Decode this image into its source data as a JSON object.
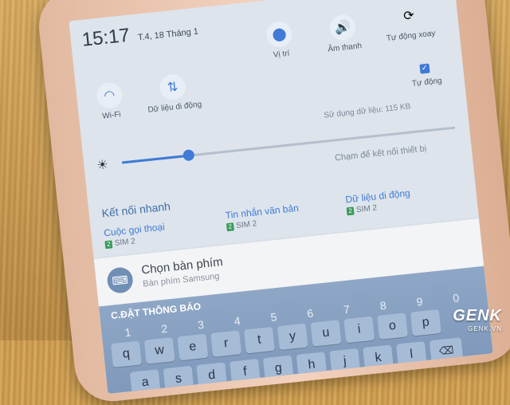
{
  "status": {
    "time": "15:17",
    "date": "T.4, 18 Tháng 1"
  },
  "toggles_row1": [
    {
      "label": "Âm thanh",
      "icon": "volume-icon",
      "active": true
    },
    {
      "label": "Tự động xoay",
      "icon": "rotate-icon",
      "active": false
    }
  ],
  "toggles_row1_left": [
    {
      "label": "Vị trí",
      "icon": "location-icon",
      "active": true
    }
  ],
  "toggles_row2": [
    {
      "label": "Wi-Fi",
      "icon": "wifi-icon",
      "active": true
    },
    {
      "label": "Dữ liệu di động",
      "icon": "mobile-data-icon",
      "active": true
    }
  ],
  "auto_brightness": {
    "label": "Tự động",
    "checked": true
  },
  "data_usage": "Sử dụng dữ liệu: 115 KB",
  "brightness_level": 0.2,
  "connect_hint": "Chạm để kết nối thiết bị",
  "quick_connect": {
    "title": "Kết nối nhanh",
    "items": [
      {
        "label": "Cuộc gọi thoại",
        "sim": "SIM 2"
      },
      {
        "label": "Tin nhắn văn bản",
        "sim": "SIM 2"
      },
      {
        "label": "Dữ liệu di động",
        "sim": "SIM 2"
      }
    ]
  },
  "notification": {
    "title": "Chọn bàn phím",
    "subtitle": "Bàn phím Samsung"
  },
  "keyboard": {
    "settings_label": "C.ĐẶT THÔNG BÁO",
    "numbers": [
      "1",
      "2",
      "3",
      "4",
      "5",
      "6",
      "7",
      "8",
      "9",
      "0"
    ],
    "row1": [
      "q",
      "w",
      "e",
      "r",
      "t",
      "y",
      "u",
      "i",
      "o",
      "p"
    ],
    "row2": [
      "a",
      "s",
      "d",
      "f",
      "g",
      "h",
      "j",
      "k",
      "l"
    ],
    "delete_symbol": "⌫"
  },
  "watermark": {
    "logo": "GENK",
    "url": "GENK.VN"
  },
  "colors": {
    "accent": "#3f7ad6",
    "sim_badge": "#3a9a5b"
  }
}
